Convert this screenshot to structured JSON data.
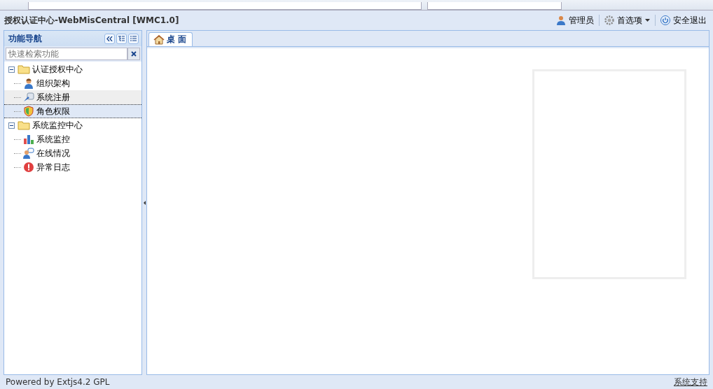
{
  "header": {
    "title": "授权认证中心-WebMisCentral [WMC1.0]",
    "actions": [
      {
        "kind": "user",
        "label": "管理员"
      },
      {
        "kind": "settings",
        "label": "首选项",
        "dropdown": true
      },
      {
        "kind": "logout",
        "label": "安全退出"
      }
    ]
  },
  "sidebar": {
    "title": "功能导航",
    "search": {
      "placeholder": "快速检索功能"
    },
    "tree": [
      {
        "label": "认证授权中心",
        "expanded": true,
        "children": [
          {
            "label": "组织架构",
            "kind": "user",
            "selected": false,
            "hovered": false
          },
          {
            "label": "系统注册",
            "kind": "register",
            "selected": false,
            "hovered": true
          },
          {
            "label": "角色权限",
            "kind": "shield",
            "selected": true,
            "hovered": false
          }
        ]
      },
      {
        "label": "系统监控中心",
        "expanded": true,
        "children": [
          {
            "label": "系统监控",
            "kind": "chart",
            "selected": false,
            "hovered": false
          },
          {
            "label": "在线情况",
            "kind": "online",
            "selected": false,
            "hovered": false
          },
          {
            "label": "异常日志",
            "kind": "error",
            "selected": false,
            "hovered": false
          }
        ]
      }
    ]
  },
  "tabs": [
    {
      "label": "桌 面",
      "selected": true
    }
  ],
  "status_bar": {
    "left": "Powered by Extjs4.2 GPL",
    "right": "系统支持"
  }
}
